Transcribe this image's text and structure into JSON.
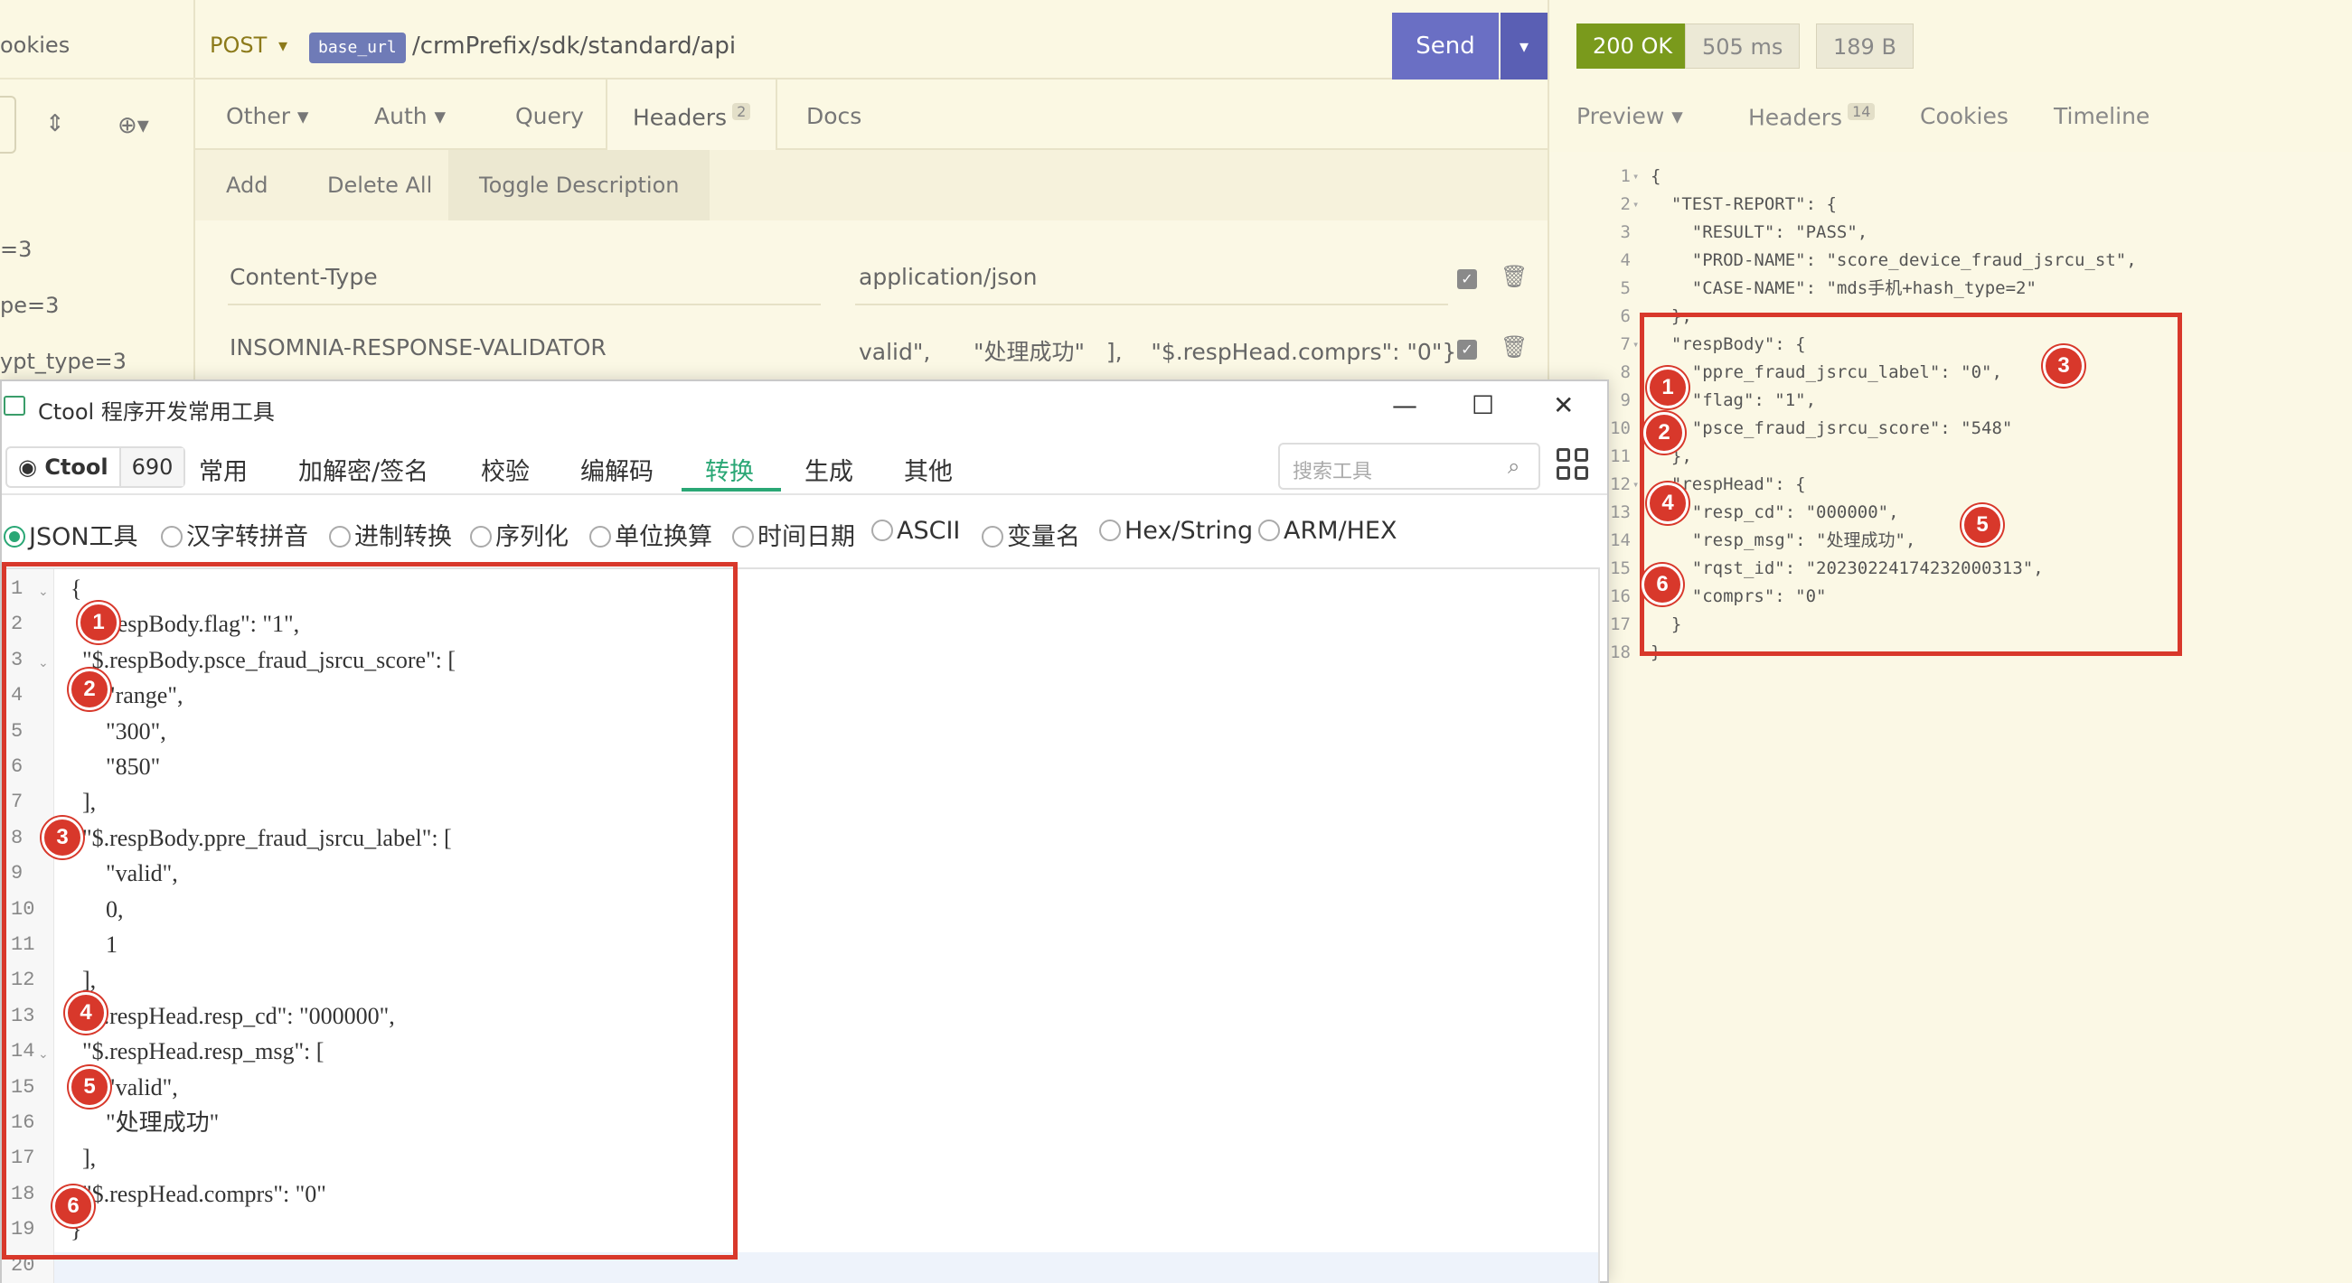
{
  "sidebar": {
    "cookies_label": "ookies",
    "items": [
      "=3",
      "pe=3",
      "ypt_type=3"
    ]
  },
  "request": {
    "method": "POST",
    "base_url_tag": "base_url",
    "url_path": "/crmPrefix/sdk/standard/api",
    "send_label": "Send",
    "tabs": {
      "other": "Other",
      "auth": "Auth",
      "query": "Query",
      "headers": "Headers",
      "headers_count": "2",
      "docs": "Docs"
    },
    "toolbar": {
      "add": "Add",
      "delete_all": "Delete All",
      "toggle_description": "Toggle Description"
    },
    "headers": [
      {
        "name": "Content-Type",
        "value": "application/json"
      },
      {
        "name": "INSOMNIA-RESPONSE-VALIDATOR",
        "value": "valid\",      \"处理成功\"   ],    \"$.respHead.comprs\": \"0\"}"
      }
    ]
  },
  "response": {
    "status": "200 OK",
    "time": "505 ms",
    "size": "189 B",
    "tabs": {
      "preview": "Preview",
      "headers": "Headers",
      "headers_count": "14",
      "cookies": "Cookies",
      "timeline": "Timeline"
    },
    "lines": [
      {
        "n": "1",
        "code": "{",
        "fold": true
      },
      {
        "n": "2",
        "code": "  \"TEST-REPORT\": {",
        "fold": true
      },
      {
        "n": "3",
        "code": "    \"RESULT\": \"PASS\","
      },
      {
        "n": "4",
        "code": "    \"PROD-NAME\": \"score_device_fraud_jsrcu_st\","
      },
      {
        "n": "5",
        "code": "    \"CASE-NAME\": \"mds手机+hash_type=2\""
      },
      {
        "n": "6",
        "code": "  },"
      },
      {
        "n": "7",
        "code": "  \"respBody\": {",
        "fold": true
      },
      {
        "n": "8",
        "code": "    \"ppre_fraud_jsrcu_label\": \"0\","
      },
      {
        "n": "9",
        "code": "    \"flag\": \"1\","
      },
      {
        "n": "10",
        "code": "    \"psce_fraud_jsrcu_score\": \"548\""
      },
      {
        "n": "11",
        "code": "  },"
      },
      {
        "n": "12",
        "code": "  \"respHead\": {",
        "fold": true
      },
      {
        "n": "13",
        "code": "    \"resp_cd\": \"000000\","
      },
      {
        "n": "14",
        "code": "    \"resp_msg\": \"处理成功\","
      },
      {
        "n": "15",
        "code": "    \"rqst_id\": \"20230224174232000313\","
      },
      {
        "n": "16",
        "code": "    \"comprs\": \"0\""
      },
      {
        "n": "17",
        "code": "  }"
      },
      {
        "n": "18",
        "code": "}"
      }
    ]
  },
  "ctool": {
    "title": "Ctool 程序开发常用工具",
    "github_label": "Ctool",
    "github_count": "690",
    "menu": [
      "常用",
      "加解密/签名",
      "校验",
      "编解码",
      "转换",
      "生成",
      "其他"
    ],
    "active_menu": "转换",
    "search_placeholder": "搜索工具",
    "tools": [
      "JSON工具",
      "汉字转拼音",
      "进制转换",
      "序列化",
      "单位换算",
      "时间日期",
      "ASCII",
      "变量名",
      "Hex/String",
      "ARM/HEX"
    ],
    "selected_tool": "JSON工具",
    "editor_lines": [
      {
        "n": "1",
        "fold": true,
        "code": "{"
      },
      {
        "n": "2",
        "code": "  \"$.respBody.flag\": \"1\","
      },
      {
        "n": "3",
        "fold": true,
        "code": "  \"$.respBody.psce_fraud_jsrcu_score\": ["
      },
      {
        "n": "4",
        "code": "      \"range\","
      },
      {
        "n": "5",
        "code": "      \"300\","
      },
      {
        "n": "6",
        "code": "      \"850\""
      },
      {
        "n": "7",
        "code": "  ],"
      },
      {
        "n": "8",
        "fold": true,
        "code": "  \"$.respBody.ppre_fraud_jsrcu_label\": ["
      },
      {
        "n": "9",
        "code": "      \"valid\","
      },
      {
        "n": "10",
        "code": "      0,"
      },
      {
        "n": "11",
        "code": "      1"
      },
      {
        "n": "12",
        "code": "  ],"
      },
      {
        "n": "13",
        "code": "  \"$.respHead.resp_cd\": \"000000\","
      },
      {
        "n": "14",
        "fold": true,
        "code": "  \"$.respHead.resp_msg\": ["
      },
      {
        "n": "15",
        "code": "      \"valid\","
      },
      {
        "n": "16",
        "code": "      \"处理成功\""
      },
      {
        "n": "17",
        "code": "  ],"
      },
      {
        "n": "18",
        "code": "  \"$.respHead.comprs\": \"0\""
      },
      {
        "n": "19",
        "code": "}"
      },
      {
        "n": "20",
        "code": ""
      }
    ]
  },
  "markers": [
    "1",
    "2",
    "3",
    "4",
    "5",
    "6"
  ],
  "colors": {
    "accent_red": "#d8382b",
    "send_purple": "#6a6fc4",
    "ok_green": "#7a9a1c",
    "ctool_green": "#2aa775",
    "base_url_tag": "#6f7bb7"
  }
}
